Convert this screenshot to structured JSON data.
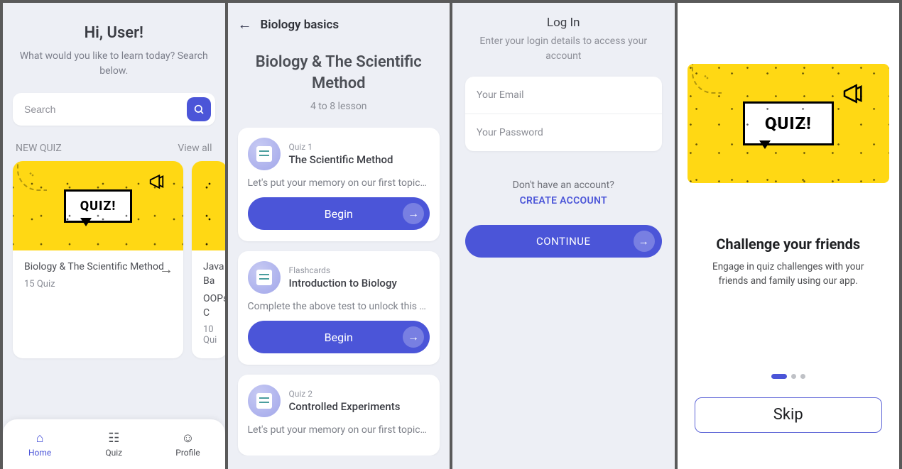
{
  "home": {
    "greeting": "Hi, User!",
    "subtitle": "What would you like to learn today? Search below.",
    "search_placeholder": "Search",
    "section_label": "NEW QUIZ",
    "view_all": "View all",
    "cards": [
      {
        "title": "Biology & The Scientific Method",
        "count": "15 Quiz"
      },
      {
        "title": "Java Ba",
        "subtitle": "OOPs C",
        "count": "10 Qui"
      }
    ],
    "nav": {
      "home": "Home",
      "quiz": "Quiz",
      "profile": "Profile"
    },
    "quiz_banner_text": "QUIZ!"
  },
  "course": {
    "back_title": "Biology basics",
    "hero_title": "Biology & The Scientific Method",
    "hero_sub": "4 to 8 lesson",
    "begin_label": "Begin",
    "lessons": [
      {
        "meta": "Quiz 1",
        "title": "The Scientific Method",
        "desc": "Let's put your memory on our first topic…"
      },
      {
        "meta": "Flashcards",
        "title": "Introduction to Biology",
        "desc": "Complete the above test to unlock this …"
      },
      {
        "meta": "Quiz 2",
        "title": "Controlled Experiments",
        "desc": "Let's put your memory on our first topic…"
      }
    ]
  },
  "login": {
    "title": "Log In",
    "subtitle": "Enter your login details to access your account",
    "email_placeholder": "Your Email",
    "password_placeholder": "Your Password",
    "noacct": "Don't have an account?",
    "create": "CREATE ACCOUNT",
    "continue": "CONTINUE"
  },
  "onboard": {
    "quiz_banner_text": "QUIZ!",
    "title": "Challenge your friends",
    "desc": "Engage in quiz challenges with your friends and family using our app.",
    "skip": "Skip"
  },
  "colors": {
    "accent": "#4b55d8",
    "banner": "#ffd814"
  }
}
